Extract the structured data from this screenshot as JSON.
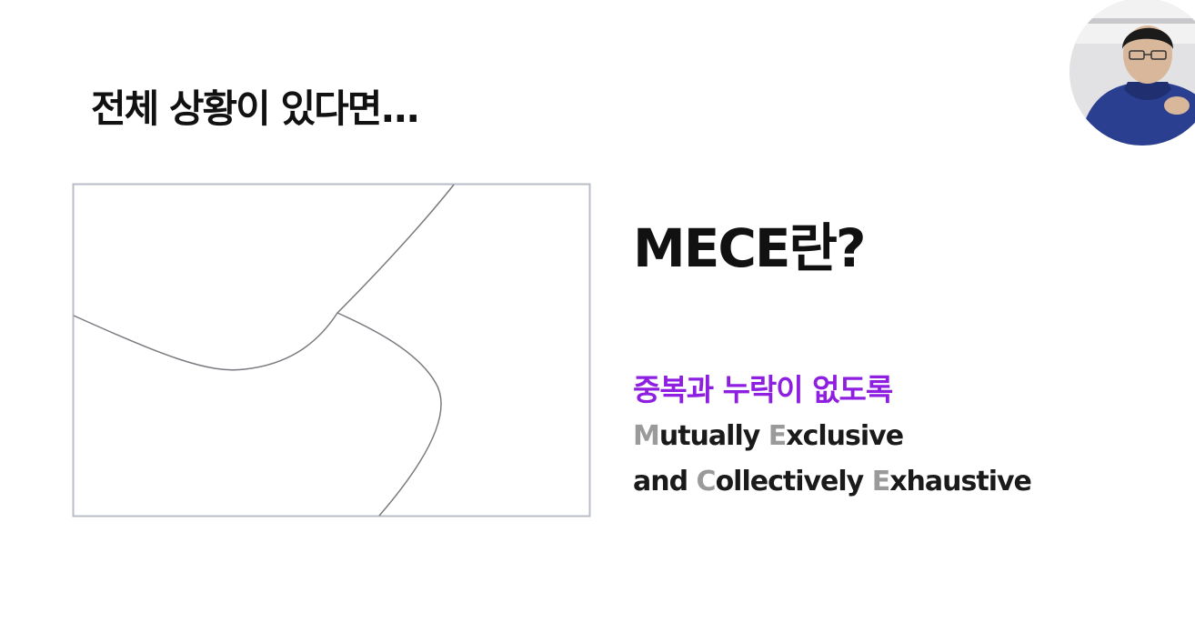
{
  "slide": {
    "heading": "전체 상황이 있다면...",
    "mece_title": "MECE란?",
    "subtitle_ko": "중복과 누락이 없도록",
    "definition": {
      "line1": [
        {
          "text": "M",
          "initial": true
        },
        {
          "text": "utually ",
          "initial": false
        },
        {
          "text": "E",
          "initial": true
        },
        {
          "text": "xclusive",
          "initial": false
        }
      ],
      "line2": [
        {
          "text": "and ",
          "initial": false
        },
        {
          "text": "C",
          "initial": true
        },
        {
          "text": "ollectively ",
          "initial": false
        },
        {
          "text": "E",
          "initial": true
        },
        {
          "text": "xhaustive",
          "initial": false
        }
      ]
    }
  },
  "colors": {
    "accent_purple": "#8f1fe0",
    "initial_gray": "#9a9a9a",
    "text": "#111111",
    "diagram_border": "#b8bcc6",
    "diagram_line": "#7a7a80"
  },
  "webcam": {
    "icon": "presenter-avatar-icon"
  }
}
